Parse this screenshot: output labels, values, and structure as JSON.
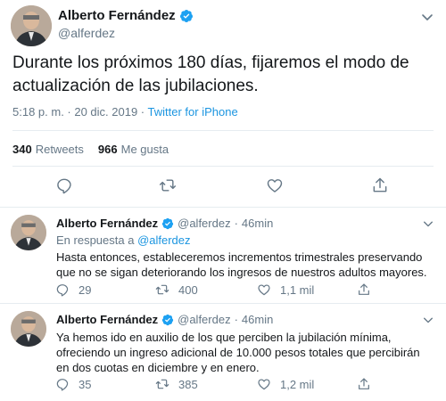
{
  "main_tweet": {
    "author_name": "Alberto Fernández",
    "author_handle": "@alferdez",
    "text": "Durante los próximos 180 días, fijaremos el modo de actualización de las jubilaciones.",
    "time": "5:18 p. m. · 20 dic. 2019 · ",
    "source": "Twitter for iPhone",
    "retweets_count": "340",
    "retweets_label": "Retweets",
    "likes_count": "966",
    "likes_label": "Me gusta"
  },
  "replies": [
    {
      "author_name": "Alberto Fernández",
      "author_handle": "@alferdez",
      "separator": "·",
      "time": "46min",
      "reply_to_prefix": "En respuesta a ",
      "reply_to_handle": "@alferdez",
      "text": "Hasta entonces, estableceremos incrementos trimestrales preservando que no se sigan deteriorando los ingresos de nuestros adultos mayores.",
      "reply_count": "29",
      "retweet_count": "400",
      "like_count": "1,1 mil"
    },
    {
      "author_name": "Alberto Fernández",
      "author_handle": "@alferdez",
      "separator": "·",
      "time": "46min",
      "text": "Ya hemos ido en auxilio de los que perciben la jubilación mínima, ofreciendo un ingreso adicional de 10.000 pesos totales que percibirán en dos cuotas en diciembre y en enero.",
      "reply_count": "35",
      "retweet_count": "385",
      "like_count": "1,2 mil"
    }
  ],
  "colors": {
    "link": "#1b95e0",
    "verified": "#1da1f2",
    "secondary_text": "#657786",
    "divider": "#e6ecf0"
  },
  "icons": [
    "verified-badge-icon",
    "chevron-down-icon",
    "reply-icon",
    "retweet-icon",
    "like-icon",
    "share-icon"
  ]
}
